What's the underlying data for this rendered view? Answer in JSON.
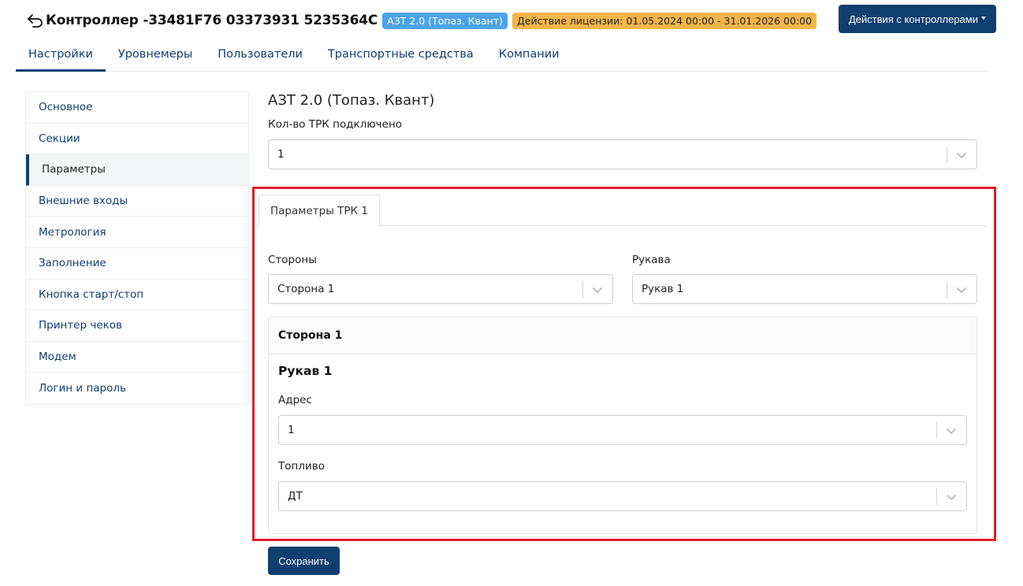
{
  "header": {
    "title": "Контроллер -33481F76 03373931 5235364C",
    "type_badge": "АЗТ 2.0 (Топаз. Квант)",
    "license_badge": "Действие лицензии: 01.05.2024 00:00 - 31.01.2026 00:00",
    "actions_label": "Действия с контроллерами"
  },
  "nav": {
    "tabs": [
      {
        "label": "Настройки"
      },
      {
        "label": "Уровнемеры"
      },
      {
        "label": "Пользователи"
      },
      {
        "label": "Транспортные средства"
      },
      {
        "label": "Компании"
      }
    ]
  },
  "sidebar": {
    "items": [
      {
        "label": "Основное"
      },
      {
        "label": "Секции"
      },
      {
        "label": "Параметры"
      },
      {
        "label": "Внешние входы"
      },
      {
        "label": "Метрология"
      },
      {
        "label": "Заполнение"
      },
      {
        "label": "Кнопка старт/стоп"
      },
      {
        "label": "Принтер чеков"
      },
      {
        "label": "Модем"
      },
      {
        "label": "Логин и пароль"
      }
    ]
  },
  "main": {
    "title": "АЗТ 2.0 (Топаз. Квант)",
    "trk_count_label": "Кол-во ТРК подключено",
    "trk_count_value": "1",
    "tab_label": "Параметры ТРК 1",
    "sides_label": "Стороны",
    "sides_value": "Сторона 1",
    "hoses_label": "Рукава",
    "hoses_value": "Рукав 1",
    "card": {
      "header": "Сторона 1",
      "subheader": "Рукав 1",
      "address_label": "Адрес",
      "address_value": "1",
      "fuel_label": "Топливо",
      "fuel_value": "ДТ"
    },
    "save_label": "Сохранить"
  },
  "colors": {
    "primary": "#0f3e6f",
    "type_badge": "#4ca3e8",
    "license_badge": "#f3b548",
    "highlight": "#e11d2a"
  }
}
